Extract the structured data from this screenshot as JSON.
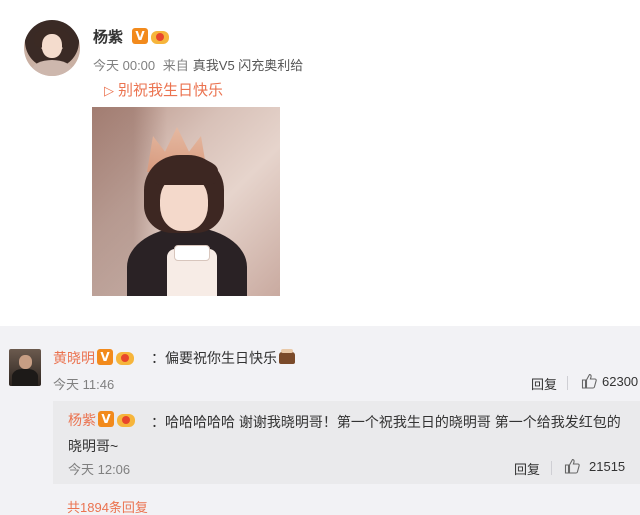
{
  "post": {
    "author": "杨紫",
    "verified_badge": "V",
    "time": "今天 00:00",
    "source_prefix": "来自",
    "source": "真我V5 闪充奥利给",
    "video_title": "别祝我生日快乐",
    "play_icon": "▷"
  },
  "comment": {
    "author": "黄晓明",
    "verified_badge": "V",
    "text": "：偏要祝你生日快乐",
    "time": "今天 11:46",
    "reply_label": "回复",
    "likes": "62300"
  },
  "sub_reply": {
    "author": "杨紫",
    "verified_badge": "V",
    "text": "：哈哈哈哈哈 谢谢我晓明哥！第一个祝我生日的晓明哥 第一个给我发红包的晓明哥~",
    "time": "今天 12:06",
    "reply_label": "回复",
    "likes": "21515"
  },
  "footer": {
    "total_replies": "共1894条回复"
  },
  "colors": {
    "accent": "#eb7350",
    "badge": "#f28a1c",
    "comment_bg": "#f2f2f5",
    "subreply_bg": "#eaeaec"
  }
}
